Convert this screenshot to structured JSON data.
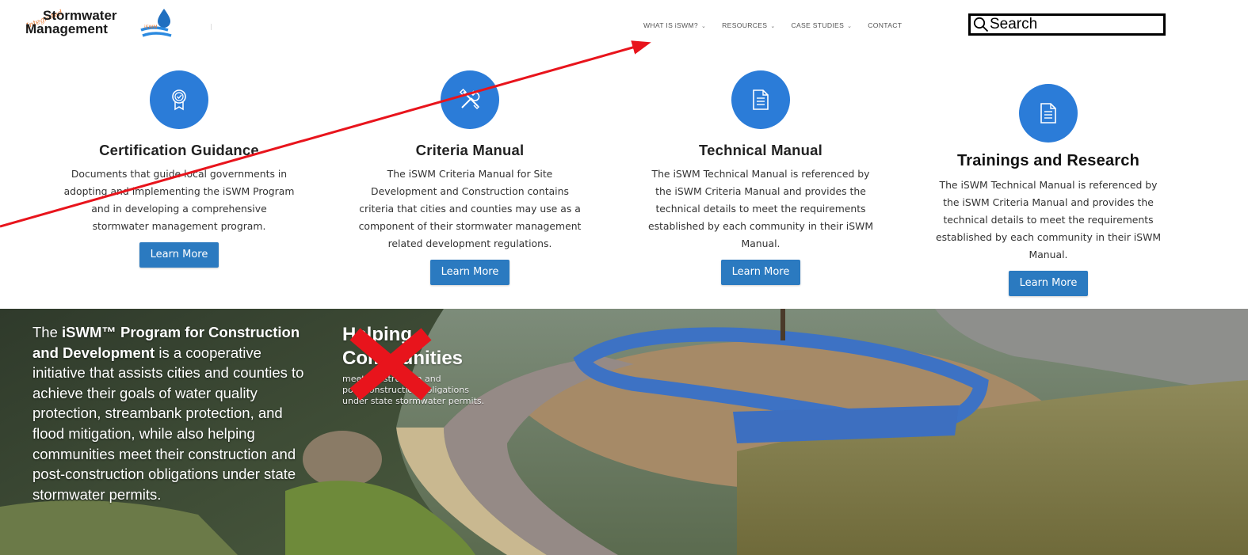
{
  "header": {
    "logo": {
      "line1": "Stormwater",
      "line2": "Management",
      "script": "Integrated"
    },
    "nav": [
      {
        "label": "WHAT IS iSWM?",
        "has_dropdown": true
      },
      {
        "label": "RESOURCES",
        "has_dropdown": true
      },
      {
        "label": "CASE STUDIES",
        "has_dropdown": true
      },
      {
        "label": "CONTACT",
        "has_dropdown": false
      }
    ],
    "search": {
      "placeholder": "Search",
      "icon": "search-icon"
    }
  },
  "cards": [
    {
      "icon": "award-ribbon-icon",
      "title": "Certification Guidance",
      "description": [
        "Documents that guide local governments in",
        "adopting and implementing the iSWM Program",
        "and in developing a comprehensive",
        "stormwater management program."
      ],
      "button": "Learn More"
    },
    {
      "icon": "tools-icon",
      "title": "Criteria Manual",
      "description": [
        "The iSWM Criteria Manual for Site",
        "Development and Construction contains",
        "criteria that cities and counties may use as a",
        "component of their stormwater management",
        "related development regulations."
      ],
      "button": "Learn More"
    },
    {
      "icon": "document-icon",
      "title": "Technical Manual",
      "description": [
        "The iSWM Technical Manual is referenced by",
        "the iSWM Criteria Manual and provides the",
        "technical details to meet the requirements",
        "established by each community in their iSWM",
        "Manual."
      ],
      "button": "Learn More"
    },
    {
      "icon": "document-icon",
      "title": "Trainings and Research",
      "description": [
        "The iSWM Technical Manual is referenced by",
        "the iSWM Criteria Manual and provides the",
        "technical details to meet the requirements",
        "established by each community in their iSWM",
        "Manual."
      ],
      "button": "Learn More"
    }
  ],
  "hero": {
    "text": {
      "part1": "The ",
      "bold": "iSWM™ Program for Construction and Development",
      "part2": " is a cooperative initiative that assists cities and counties to achieve their goals of water quality protection, streambank protection, and flood mitigation, while also helping communities meet their construction and post-construction obligations under state stormwater permits."
    },
    "crossed_out_heading": [
      "Helping",
      "Communities"
    ],
    "crossed_out_body": [
      "meet construction and",
      "post-construction obligations",
      "under state stormwater permits."
    ]
  },
  "annotations": {
    "arrow_color": "#e8141c",
    "x_mark_color": "#e8141c"
  }
}
